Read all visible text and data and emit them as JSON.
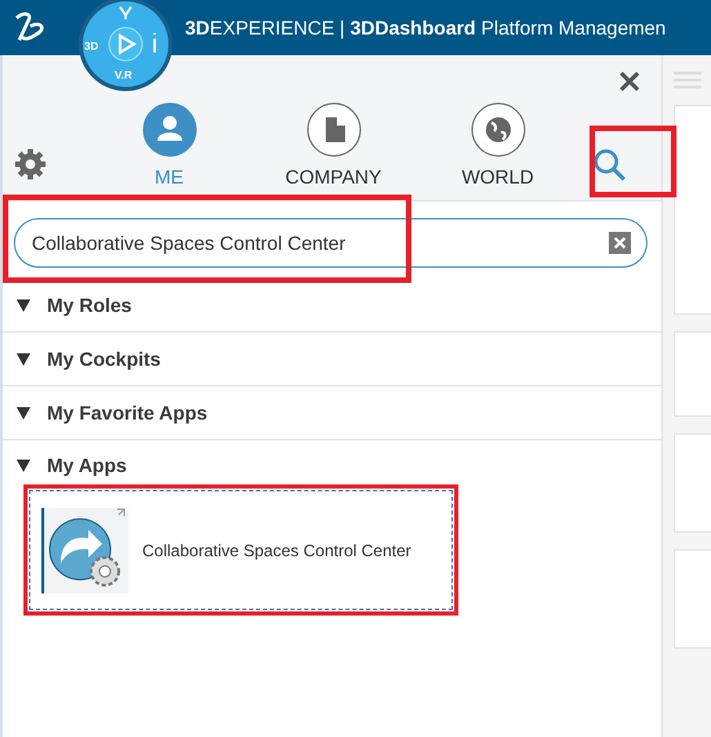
{
  "top_bar": {
    "title": "**3D**EXPERIENCE | **3DDashboard**  Platform Managemen",
    "compass": {
      "west": "3D",
      "south": "V.R"
    }
  },
  "panel": {
    "tabs": [
      {
        "label": "ME",
        "selected": true
      },
      {
        "label": "COMPANY",
        "selected": false
      },
      {
        "label": "WORLD",
        "selected": false
      }
    ],
    "search": {
      "value": "Collaborative Spaces Control Center",
      "highlighted": true
    },
    "search_button_highlighted": true,
    "sections": [
      {
        "title": "My Roles",
        "expanded": true
      },
      {
        "title": "My Cockpits",
        "expanded": true
      },
      {
        "title": "My Favorite Apps",
        "expanded": true
      },
      {
        "title": "My Apps",
        "expanded": true
      }
    ],
    "apps": [
      {
        "name": "Collaborative Spaces Control Center",
        "selected": true
      }
    ]
  }
}
